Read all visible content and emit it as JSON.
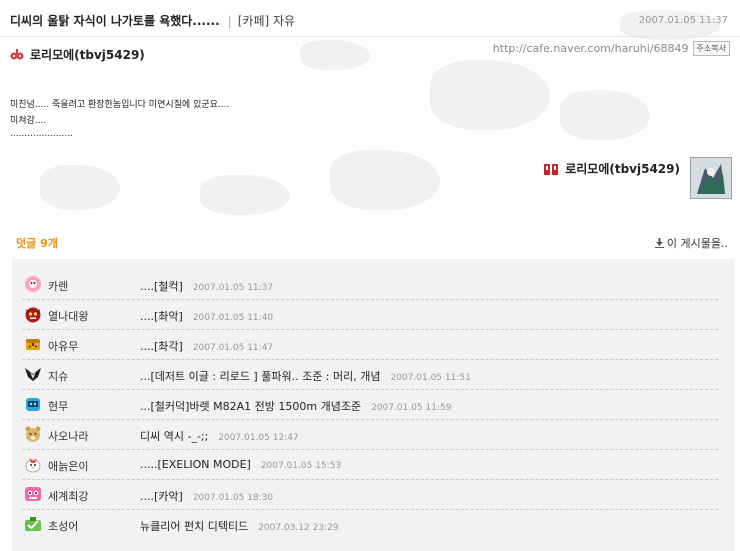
{
  "post": {
    "title": "디씨의 울탉 자식이 나가토를 욕했다......",
    "separator": "|",
    "category": "[카페] 자유",
    "date": "2007.01.05 11:37",
    "author": "로리모에(tbvj5429)",
    "url": "http://cafe.naver.com/haruhi/68849",
    "copy_label": "주소복사",
    "body": [
      "미친넘..... 죽을려고 환장한놈입니다 미연시질에 있군요....",
      "미쳐감....",
      "......................"
    ],
    "signature_name": "로리모에(tbvj5429)"
  },
  "comments_header": {
    "label": "덧글",
    "count": "9개",
    "list_link": "이 게시물을.."
  },
  "comments": [
    {
      "name": "카렌",
      "text": "....[철컥]",
      "time": "2007.01.05 11:37",
      "avatar": "pink-flower-avatar-icon"
    },
    {
      "name": "열나대왕",
      "text": "....[촤악]",
      "time": "2007.01.05 11:40",
      "avatar": "red-demon-avatar-icon"
    },
    {
      "name": "아유무",
      "text": "....[촤각]",
      "time": "2007.01.05 11:47",
      "avatar": "treasure-chest-avatar-icon"
    },
    {
      "name": "지슈",
      "text": "...[데저트 이글 : 리로드 ] 풀파워.. 조준 : 머리, 개념",
      "time": "2007.01.05 11:51",
      "avatar": "black-bird-avatar-icon"
    },
    {
      "name": "현무",
      "text": "...[철커덕]바렛 M82A1 전방 1500m 개념조준",
      "time": "2007.01.05 11:59",
      "avatar": "blue-creature-avatar-icon"
    },
    {
      "name": "사오나라",
      "text": "디씨 역시 -_-;;",
      "time": "2007.01.05 12:47",
      "avatar": "bear-avatar-icon"
    },
    {
      "name": "애늙은이",
      "text": ".....[EXELION MODE]",
      "time": "2007.01.05 15:53",
      "avatar": "white-bird-avatar-icon"
    },
    {
      "name": "세계최강",
      "text": "....[카악]",
      "time": "2007.01.05 18:30",
      "avatar": "pink-skull-avatar-icon"
    },
    {
      "name": "초성어",
      "text": "뉴클리어 펀치 디텍티드",
      "time": "2007.03.12 23:29",
      "avatar": "green-check-avatar-icon"
    }
  ]
}
